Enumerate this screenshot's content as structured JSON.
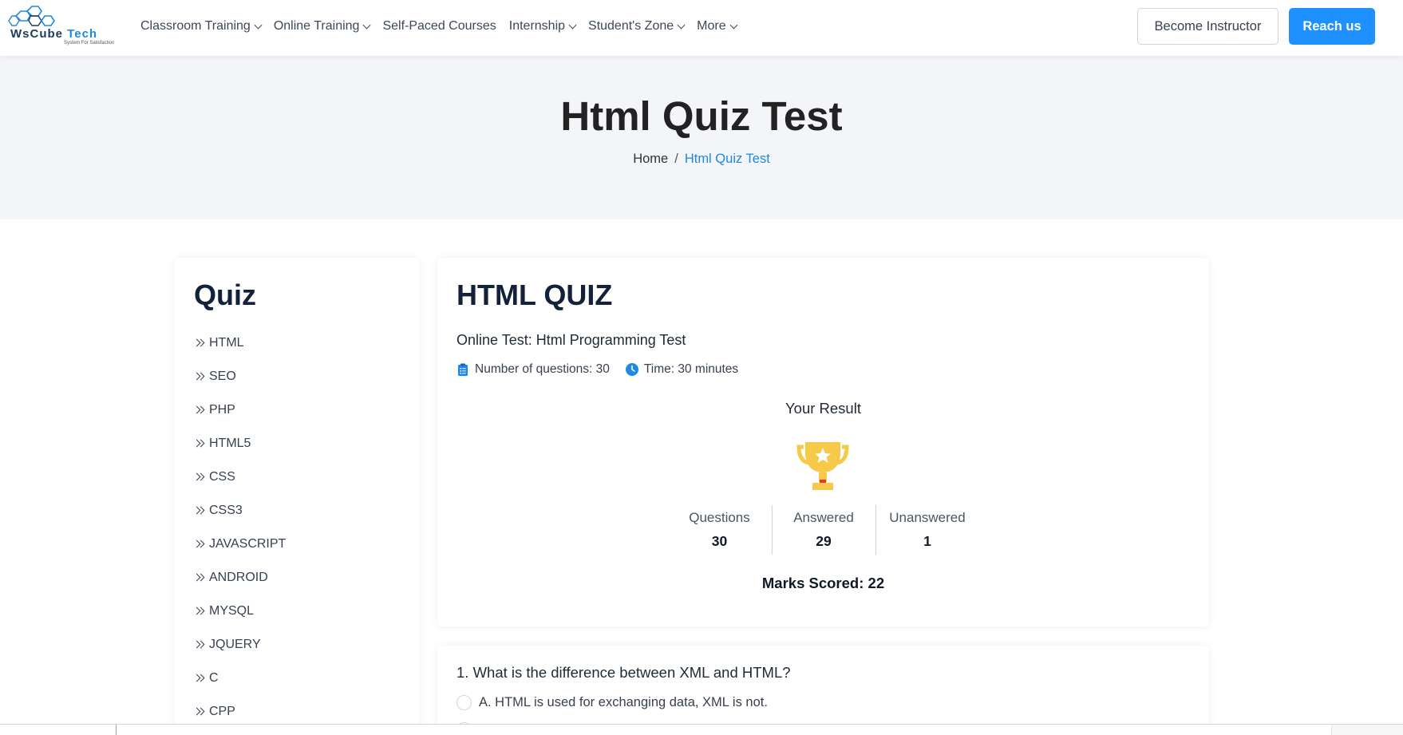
{
  "header": {
    "logo_text_main": "WsCube",
    "logo_text_tech": "Tech",
    "logo_tagline": "System For Satisfaction",
    "nav": [
      {
        "label": "Classroom Training",
        "dropdown": true
      },
      {
        "label": "Online Training",
        "dropdown": true
      },
      {
        "label": "Self-Paced Courses",
        "dropdown": false
      },
      {
        "label": "Internship",
        "dropdown": true
      },
      {
        "label": "Student's Zone",
        "dropdown": true
      },
      {
        "label": "More",
        "dropdown": true
      }
    ],
    "become_instructor": "Become Instructor",
    "reach_us": "Reach us"
  },
  "hero": {
    "title": "Html Quiz Test",
    "breadcrumb_home": "Home",
    "breadcrumb_sep": "/",
    "breadcrumb_current": "Html Quiz Test"
  },
  "sidebar": {
    "title": "Quiz",
    "items": [
      "HTML",
      "SEO",
      "PHP",
      "HTML5",
      "CSS",
      "CSS3",
      "JAVASCRIPT",
      "ANDROID",
      "MYSQL",
      "JQUERY",
      "C",
      "CPP"
    ]
  },
  "quiz": {
    "title": "HTML QUIZ",
    "subtitle": "Online Test: Html Programming Test",
    "num_questions_label": "Number of questions: 30",
    "time_label": "Time: 30 minutes",
    "result_label": "Your Result",
    "stats": [
      {
        "label": "Questions",
        "value": "30"
      },
      {
        "label": "Answered",
        "value": "29"
      },
      {
        "label": "Unanswered",
        "value": "1"
      }
    ],
    "marks_scored": "Marks Scored: 22"
  },
  "question": {
    "text": "1. What is the difference between XML and HTML?",
    "options": [
      "A. HTML is used for exchanging data, XML is not."
    ]
  },
  "colors": {
    "accent": "#1e90ff",
    "hero_bg": "#f3f5f9",
    "heading": "#13223a",
    "trophy_gold": "#f7c948"
  }
}
